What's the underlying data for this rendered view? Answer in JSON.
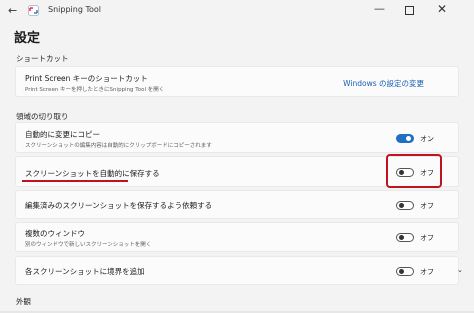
{
  "window": {
    "back_glyph": "←",
    "app_title": "Snipping Tool",
    "minimize_glyph": "—",
    "close_glyph": "✕",
    "app_icon": "snipping-tool-icon"
  },
  "page": {
    "title": "設定"
  },
  "sections": {
    "shortcut": "ショートカット",
    "snipping": "領域の切り取り",
    "appearance": "外観"
  },
  "shortcut_card": {
    "title": "Print Screen キーのショートカット",
    "subtitle": "Print Screen キーを押したときにSnipping Tool を開く",
    "link": "Windows の設定の変更"
  },
  "settings": [
    {
      "title": "自動的に変更にコピー",
      "subtitle": "スクリーンショットの編集内容は自動的にクリップボードにコピーされます",
      "state": "on",
      "state_label": "オン"
    },
    {
      "title": "スクリーンショットを自動的に保存する",
      "subtitle": "",
      "state": "off",
      "state_label": "オフ"
    },
    {
      "title": "編集済みのスクリーンショットを保存するよう依頼する",
      "subtitle": "",
      "state": "off",
      "state_label": "オフ"
    },
    {
      "title": "複数のウィンドウ",
      "subtitle": "別のウィンドウで新しいスクリーンショットを開く",
      "state": "off",
      "state_label": "オフ"
    },
    {
      "title": "各スクリーンショットに境界を追加",
      "subtitle": "",
      "state": "off",
      "state_label": "オフ",
      "expand_glyph": "⌄"
    }
  ],
  "colors": {
    "accent": "#1f6fc5",
    "annotation": "#c1121f",
    "background": "#f3f3f3",
    "card": "#fbfbfb"
  }
}
